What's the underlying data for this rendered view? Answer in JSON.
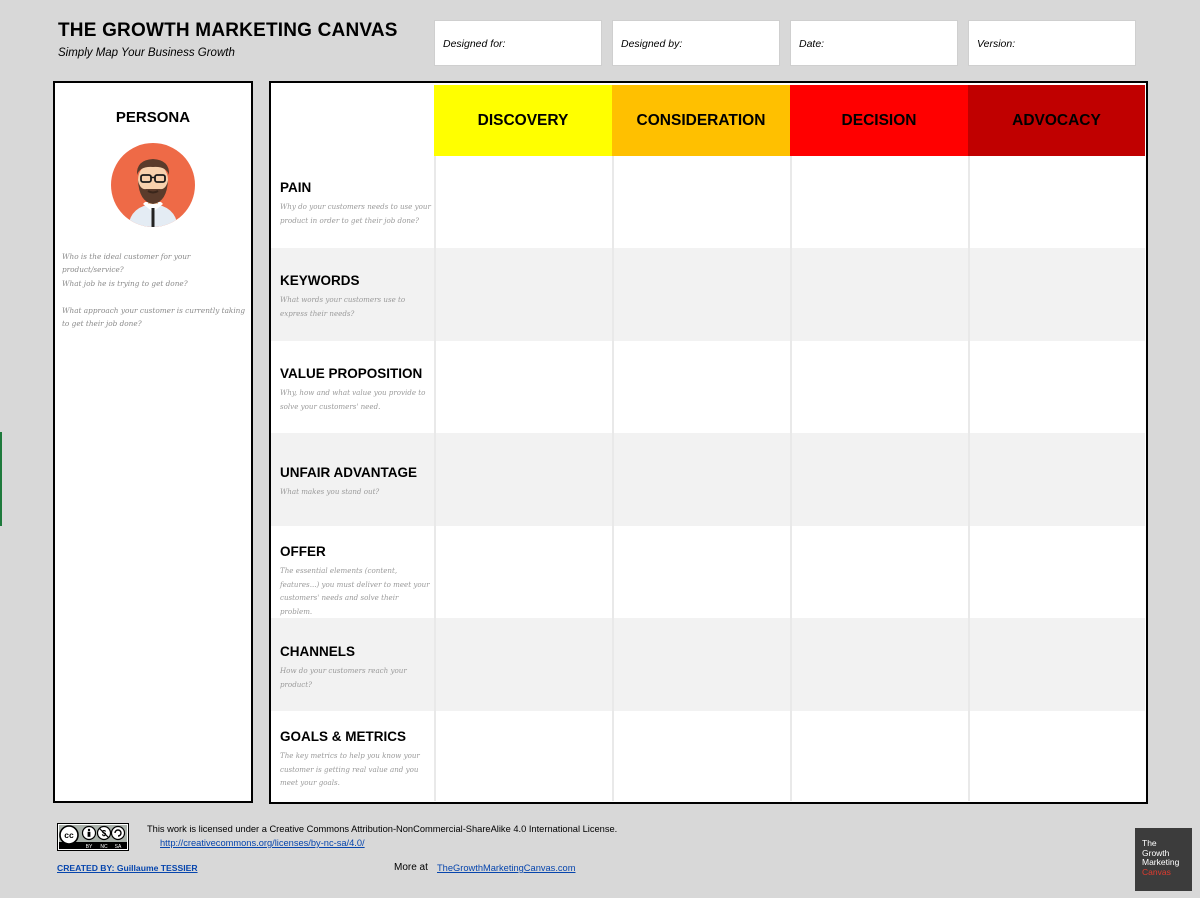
{
  "header": {
    "title": "THE GROWTH MARKETING CANVAS",
    "subtitle": "Simply Map Your Business Growth",
    "meta_fields": [
      {
        "label": "Designed for:"
      },
      {
        "label": "Designed by:"
      },
      {
        "label": "Date:"
      },
      {
        "label": "Version:"
      }
    ]
  },
  "persona": {
    "title": "PERSONA",
    "questions": [
      "Who is the ideal customer for your product/service?",
      "What job he is trying to get done?",
      "What approach your customer is currently taking to get their job done?"
    ]
  },
  "stages": [
    {
      "label": "DISCOVERY",
      "color": "#ffff00"
    },
    {
      "label": "CONSIDERATION",
      "color": "#ffc000"
    },
    {
      "label": "DECISION",
      "color": "#ff0000"
    },
    {
      "label": "ADVOCACY",
      "color": "#c00000"
    }
  ],
  "rows": [
    {
      "title": "PAIN",
      "desc": "Why do your customers needs to use your product in order to get their job done?"
    },
    {
      "title": "KEYWORDS",
      "desc": "What words your customers use to express their needs?"
    },
    {
      "title": "VALUE PROPOSITION",
      "desc": "Why, how and what value you provide to solve your customers' need."
    },
    {
      "title": "UNFAIR ADVANTAGE",
      "desc": "What makes you stand out?"
    },
    {
      "title": "OFFER",
      "desc": "The essential elements (content, features...) you must deliver to meet your customers' needs and solve their problem."
    },
    {
      "title": "CHANNELS",
      "desc": "How do your customers reach your product?"
    },
    {
      "title": "GOALS & METRICS",
      "desc": "The key metrics to help you know your customer is getting real value and you meet your goals."
    }
  ],
  "colors": {
    "row_alt": "#f2f2f2",
    "avatar_bg": "#ee6a47"
  },
  "footer": {
    "license_text": "This work is licensed under a Creative Commons Attribution-NonCommercial-ShareAlike 4.0 International License.",
    "license_url": "http://creativecommons.org/licenses/by-nc-sa/4.0/",
    "created_by": "CREATED BY: Guillaume TESSIER",
    "more_at": "More at",
    "site": "TheGrowthMarketingCanvas.com",
    "badge": {
      "cc": "cc",
      "labels": [
        "BY",
        "NC",
        "SA"
      ]
    },
    "logo": {
      "line1": "The",
      "line2": "Growth",
      "line3": "Marketing",
      "line4": "Canvas"
    }
  }
}
